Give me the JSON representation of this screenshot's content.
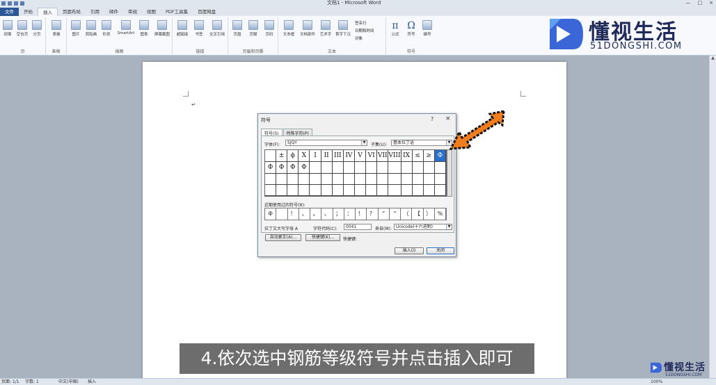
{
  "window": {
    "title": "文档1 - Microsoft Word",
    "controls": [
      "—",
      "□",
      "×"
    ]
  },
  "tabs": [
    "文件",
    "开始",
    "插入",
    "页面布局",
    "引用",
    "邮件",
    "审阅",
    "视图",
    "PDF工具集",
    "百度网盘"
  ],
  "active_tab": "插入",
  "ribbon": {
    "groups": [
      {
        "label": "页",
        "buttons": [
          "封面",
          "空白页",
          "分页"
        ]
      },
      {
        "label": "表格",
        "buttons": [
          "表格"
        ]
      },
      {
        "label": "插图",
        "buttons": [
          "图片",
          "剪贴画",
          "形状",
          "SmartArt",
          "图表",
          "屏幕截图"
        ]
      },
      {
        "label": "链接",
        "buttons": [
          "超链接",
          "书签",
          "交叉引用"
        ]
      },
      {
        "label": "页眉和页脚",
        "buttons": [
          "页眉",
          "页脚",
          "页码"
        ]
      },
      {
        "label": "文本",
        "buttons": [
          "文本框",
          "文档部件",
          "艺术字",
          "首字下沉"
        ],
        "side": [
          "签名行",
          "日期和时间",
          "对象"
        ]
      },
      {
        "label": "符号",
        "buttons": [
          "公式",
          "符号",
          "编号"
        ]
      }
    ]
  },
  "logo": {
    "cn": "懂视生活",
    "en": "51DONGSHI.COM"
  },
  "document": {
    "paragraph_mark": "↵"
  },
  "dialog": {
    "title": "符号",
    "help": "?",
    "close": "×",
    "tabs": [
      "符号(S)",
      "特殊字符(P)"
    ],
    "font_label": "字体(F):",
    "font_value": "SJQY",
    "subset_label": "子集(U):",
    "subset_value": "基本拉丁语",
    "grid": [
      [
        "",
        "±",
        "ϕ",
        "X",
        "I",
        "II",
        "III",
        "IV",
        "V",
        "VI",
        "VII",
        "VIII",
        "IX",
        "≤",
        "≥",
        "Φ"
      ],
      [
        "Φ",
        "Φ",
        "Φ",
        "Φ",
        "",
        "",
        "",
        "",
        "",
        "",
        "",
        "",
        "",
        "",
        "",
        ""
      ],
      [
        "",
        "",
        "",
        "",
        "",
        "",
        "",
        "",
        "",
        "",
        "",
        "",
        "",
        "",
        "",
        ""
      ],
      [
        "",
        "",
        "",
        "",
        "",
        "",
        "",
        "",
        "",
        "",
        "",
        "",
        "",
        "",
        "",
        ""
      ]
    ],
    "selected_index": 15,
    "recent_label": "近期使用过的符号(R):",
    "recent": [
      "Φ",
      "",
      "！",
      "，",
      "。",
      "、",
      "；",
      "：",
      "！",
      "？",
      "“",
      "”",
      "（",
      "【",
      "）",
      "%"
    ],
    "name_label": "拉丁文大写字母 A",
    "code_label": "字符代码(C):",
    "code_value": "0041",
    "from_label": "来自(M):",
    "from_value": "Unicode(十六进制)",
    "autocorrect_button": "自动更正(A)...",
    "shortcut_button": "快捷键(K)...",
    "shortcut_label": "快捷键:",
    "insert_button": "插入(I)",
    "cancel_button": "关闭"
  },
  "caption": "4.依次选中钢筋等级符号并点击插入即可",
  "watermark": {
    "cn": "懂视生活",
    "en": "51DONGSHI.COM"
  },
  "status": {
    "page": "页面: 1/1",
    "words": "字数: 1",
    "language": "中文(中国)",
    "mode": "插入",
    "zoom": "100%"
  },
  "colors": {
    "accent": "#2a6fc9",
    "file_tab": "#2b5797",
    "arrow": "#f07d1e",
    "logo": "#1f2a5a"
  }
}
